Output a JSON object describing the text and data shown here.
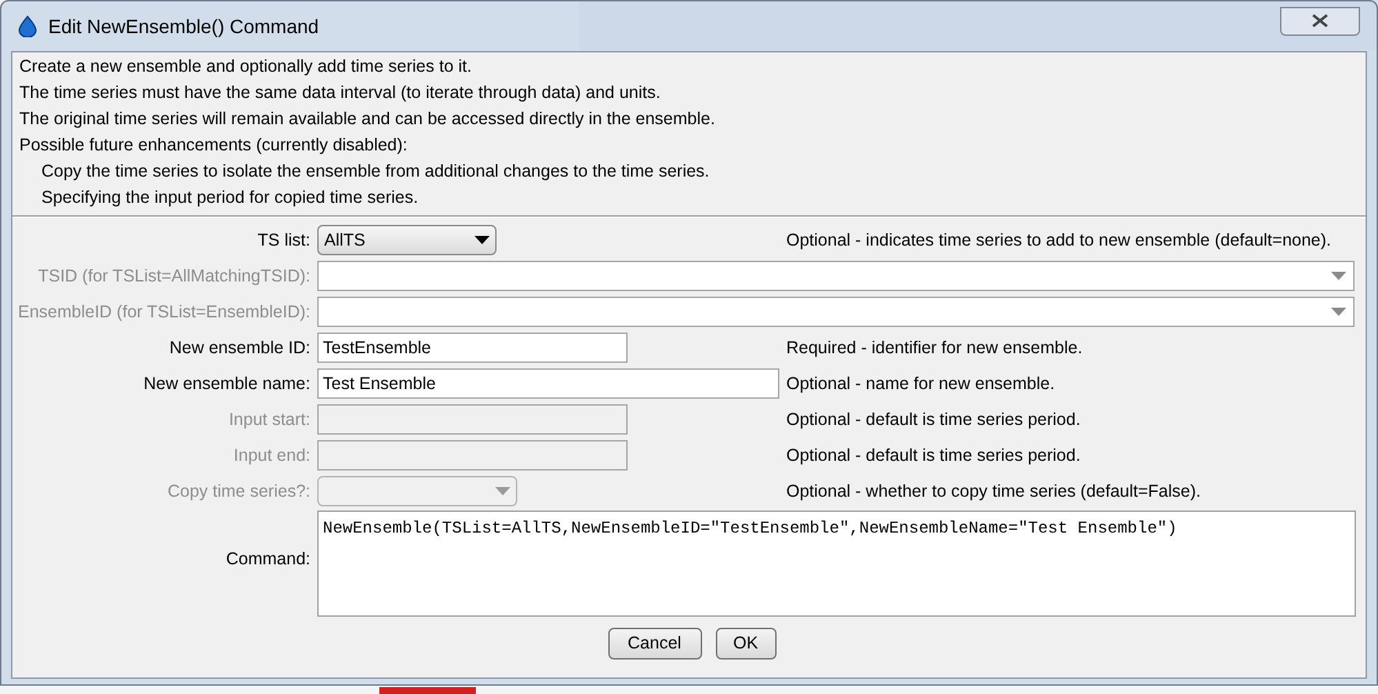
{
  "window": {
    "title": "Edit NewEnsemble() Command"
  },
  "description": [
    {
      "text": "Create a new ensemble and optionally add time series to it.",
      "indented": false
    },
    {
      "text": "The time series must have the same data interval (to iterate through data) and units.",
      "indented": false
    },
    {
      "text": "The original time series will remain available and can be accessed directly in the ensemble.",
      "indented": false
    },
    {
      "text": "Possible future enhancements (currently disabled):",
      "indented": false
    },
    {
      "text": "Copy the time series to isolate the ensemble from additional changes to the time series.",
      "indented": true
    },
    {
      "text": "Specifying the input period for copied time series.",
      "indented": true
    }
  ],
  "fields": [
    {
      "label": "TS list:",
      "kind": "choice",
      "value": "AllTS",
      "disabled": false,
      "note": "Optional - indicates time series to add to new ensemble (default=none)."
    },
    {
      "label": "TSID (for TSList=AllMatchingTSID):",
      "kind": "combo",
      "disabled": true
    },
    {
      "label": "EnsembleID (for TSList=EnsembleID):",
      "kind": "combo",
      "disabled": true
    },
    {
      "label": "New ensemble ID:",
      "kind": "text",
      "value": "TestEnsemble",
      "disabled": false,
      "note": "Required - identifier for new ensemble."
    },
    {
      "label": "New ensemble name:",
      "kind": "text",
      "value": "Test Ensemble",
      "disabled": false,
      "note": "Optional - name for new ensemble."
    },
    {
      "label": "Input start:",
      "kind": "text",
      "disabled": true,
      "note": "Optional - default is time series period."
    },
    {
      "label": "Input end:",
      "kind": "text",
      "disabled": true,
      "note": "Optional - default is time series period."
    },
    {
      "label": "Copy time series?:",
      "kind": "choice",
      "disabled": true,
      "note": "Optional - whether to copy time series (default=False)."
    }
  ],
  "command": {
    "label": "Command:",
    "value": "NewEnsemble(TSList=AllTS,NewEnsembleID=\"TestEnsemble\",NewEnsembleName=\"Test Ensemble\")"
  },
  "buttons": [
    "Cancel",
    "OK"
  ]
}
